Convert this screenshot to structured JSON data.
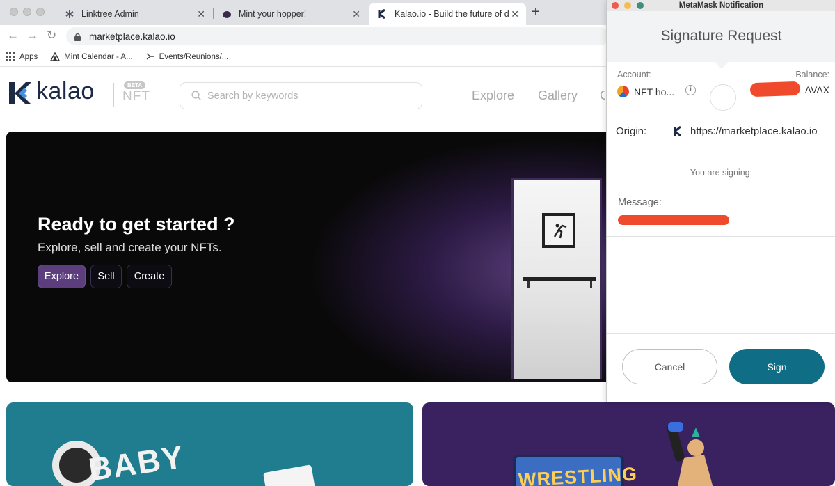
{
  "browser": {
    "tabs": [
      {
        "title": "Linktree Admin",
        "icon": "linktree-icon"
      },
      {
        "title": "Mint your hopper!",
        "icon": "hopper-icon"
      },
      {
        "title": "Kalao.io - Build the future of d",
        "icon": "kalao-icon"
      }
    ],
    "url": "marketplace.kalao.io",
    "bookmarks": [
      {
        "label": "Apps",
        "icon": "apps-grid-icon"
      },
      {
        "label": "Mint Calendar - A...",
        "icon": "triangle-icon"
      },
      {
        "label": "Events/Reunions/...",
        "icon": "events-icon"
      }
    ]
  },
  "kalao": {
    "logo": "kalao",
    "beta": "BETA",
    "nft": "NFT",
    "search_placeholder": "Search by keywords",
    "nav": [
      "Explore",
      "Gallery"
    ],
    "hero": {
      "title": "Ready to get started ?",
      "subtitle": "Explore, sell and create your NFTs.",
      "buttons": [
        "Explore",
        "Sell",
        "Create"
      ]
    },
    "cards": [
      {
        "art_text": "BABY"
      },
      {
        "art_text": "WRESTLING"
      }
    ]
  },
  "metamask": {
    "window_title": "MetaMask Notification",
    "title": "Signature Request",
    "account_label": "Account:",
    "account_name": "NFT ho...",
    "balance_label": "Balance:",
    "balance_unit": "AVAX",
    "origin_label": "Origin:",
    "origin_value": "https://marketplace.kalao.io",
    "signing_text": "You are signing:",
    "message_label": "Message:",
    "cancel": "Cancel",
    "sign": "Sign",
    "colors": {
      "sign_button": "#0f6e86",
      "redaction": "#f04a2c"
    }
  }
}
